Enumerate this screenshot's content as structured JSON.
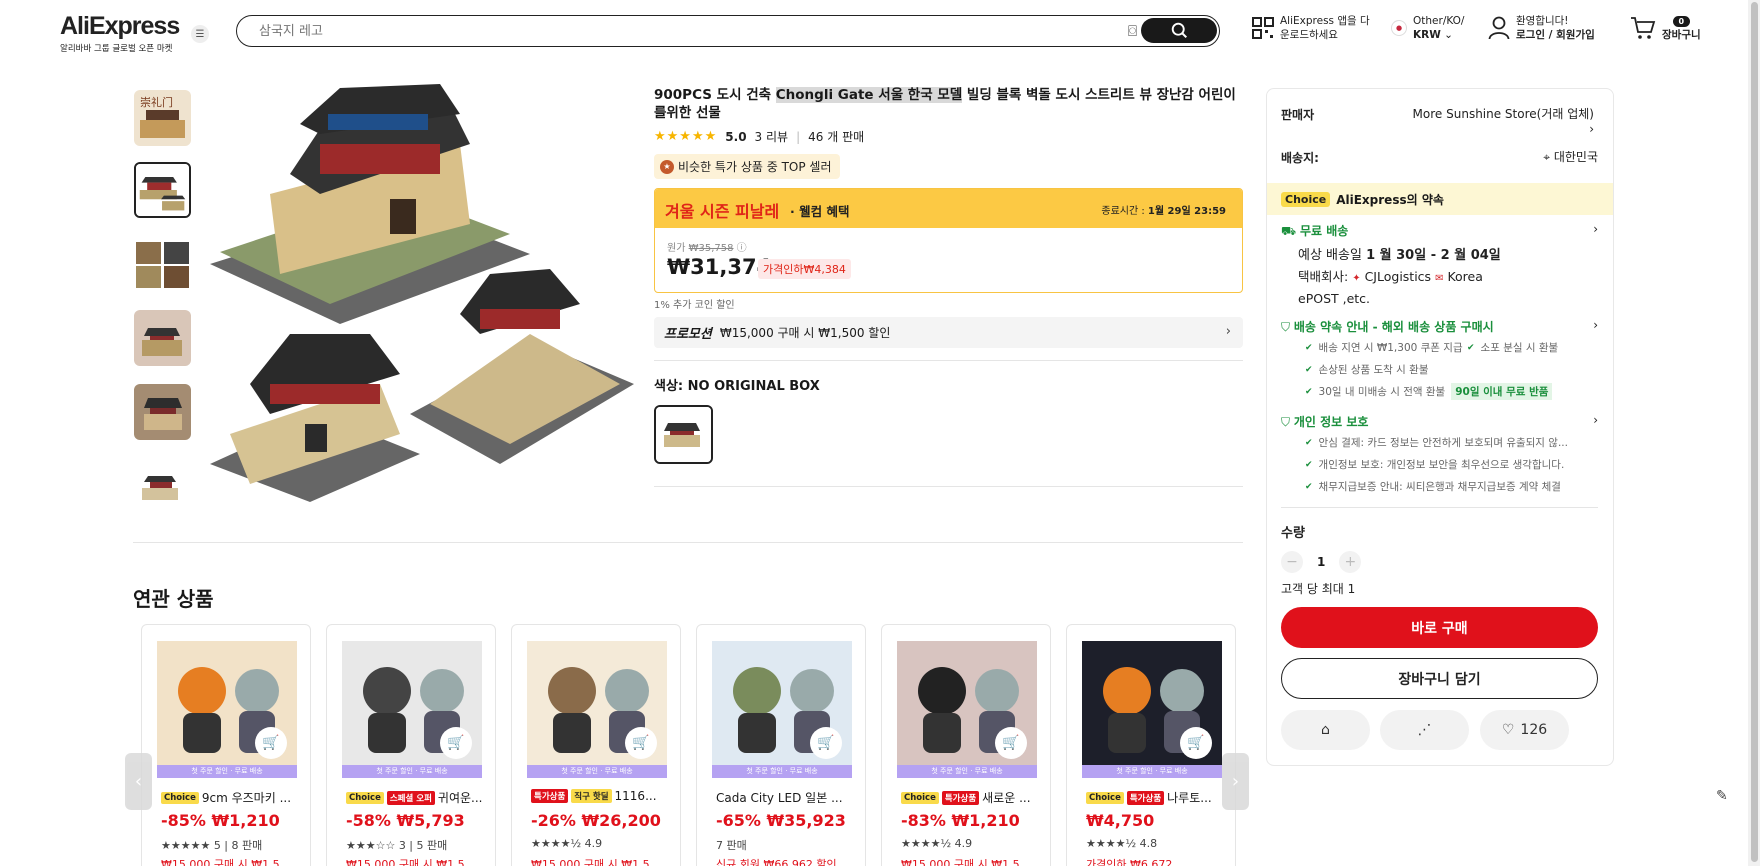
{
  "header": {
    "logo_text": "AliExpress",
    "logo_tagline": "알리바바 그룹 글로벌 오픈 마켓",
    "search_placeholder": "삼국지 레고",
    "app_download": "AliExpress 앱을 다운로드하세요",
    "region_line1": "Other/KO/",
    "region_line2": "KRW",
    "welcome": "환영합니다!",
    "login": "로그인 / 회원가입",
    "cart_count": "0",
    "cart_label": "장바구니"
  },
  "product": {
    "title_pre": "900PCS 도시 건축 ",
    "title_hl": "Chongli Gate 서울 한국 모델",
    "title_post": " 빌딩 블록 벽돌 도시 스트리트 뷰 장난감 어린이를위한 선물",
    "rating": "5.0",
    "reviews": "3 리뷰",
    "sold": "46 개 판매",
    "top_seller": "비슷한 특가 상품 중 TOP 셀러",
    "event_title": "겨울 시즌 피날레",
    "event_sub": "· 웰컴 혜택",
    "end_label": "종료시간 :",
    "end_time": "1월 29일 23:59",
    "orig_label": "원가",
    "orig_price": "₩35,758",
    "price": "₩31,374",
    "discount": "가격인하₩4,384",
    "coin_note": "1% 추가 코인 할인",
    "promo_label": "프로모션",
    "promo_text": "₩15,000 구매 시 ₩1,500 할인",
    "color_label": "색상: NO ORIGINAL BOX"
  },
  "panel": {
    "seller_label": "판매자",
    "seller_name": "More Sunshine Store(거래 업체)",
    "ship_to_label": "배송지:",
    "ship_to": "대한민국",
    "choice_tag": "Choice",
    "choice_text": "AliExpress의 약속",
    "free_ship": "무료 배송",
    "est_label": "예상 배송일",
    "est_date": "1 월 30일 - 2 월 04일",
    "carrier_label": "택배회사:",
    "carrier": "CJLogistics",
    "carrier2": "Korea",
    "carrier3": "ePOST ,etc.",
    "guarantee_title": "배송 약속 안내 - 해외 배송 상품 구매시",
    "g1": "배송 지연 시 ₩1,300 쿠폰 지급",
    "g1b": "소포 분실 시 환불",
    "g2": "손상된 상품 도착 시 환불",
    "g3": "30일 내 미배송 시 전액 환불",
    "g3tag": "90일 이내 무료 반품",
    "privacy_title": "개인 정보 보호",
    "p1": "안심 결제: 카드 정보는 안전하게 보호되며 유출되지 않...",
    "p2": "개인정보 보호: 개인정보 보안을 최우선으로 생각합니다.",
    "p3": "채무지급보증 안내: 씨티은행과 채무지급보증 계약 체결",
    "qty_label": "수량",
    "qty": "1",
    "limit": "고객 당 최대 1",
    "buy_now": "바로 구매",
    "add_cart": "장바구니 담기",
    "wish_count": "126"
  },
  "related": {
    "title": "연관 상품",
    "ribbon": "첫 주문 할인 · 무료 배송",
    "items": [
      {
        "tags": [
          "Choice"
        ],
        "name": "9cm 우즈마키 ...",
        "disc": "-85%",
        "price": "₩1,210",
        "stars": "★★★★★",
        "meta": "5 | 8 판매",
        "promo": "₩15,000 구매 시 ₩1,5"
      },
      {
        "tags": [
          "Choice",
          "스페셜 오퍼"
        ],
        "name": "귀여운...",
        "disc": "-58%",
        "price": "₩5,793",
        "stars": "★★★☆☆",
        "meta": "3 | 5 판매",
        "promo": "₩15,000 구매 시 ₩1,5"
      },
      {
        "tags": [
          "특가상품",
          "직구 핫딜"
        ],
        "name": "1116...",
        "disc": "-26%",
        "price": "₩26,200",
        "stars": "★★★★½",
        "meta": "4.9",
        "promo": "₩15,000 구매 시 ₩1,5"
      },
      {
        "tags": [],
        "name": "Cada City LED 일본 ...",
        "disc": "-65%",
        "price": "₩35,923",
        "stars": "",
        "meta": "7 판매",
        "promo": "신규 회원 ₩66,962 할인"
      },
      {
        "tags": [
          "Choice",
          "특가상품"
        ],
        "name": "새로운 ...",
        "disc": "-83%",
        "price": "₩1,210",
        "stars": "★★★★½",
        "meta": "4.9",
        "promo": "₩15,000 구매 시 ₩1,5"
      },
      {
        "tags": [
          "Choice",
          "특가상품"
        ],
        "name": "나루토...",
        "disc": "",
        "price": "₩4,750",
        "stars": "★★★★½",
        "meta": "4.8",
        "promo": "가격인하 ₩6,672"
      }
    ]
  }
}
